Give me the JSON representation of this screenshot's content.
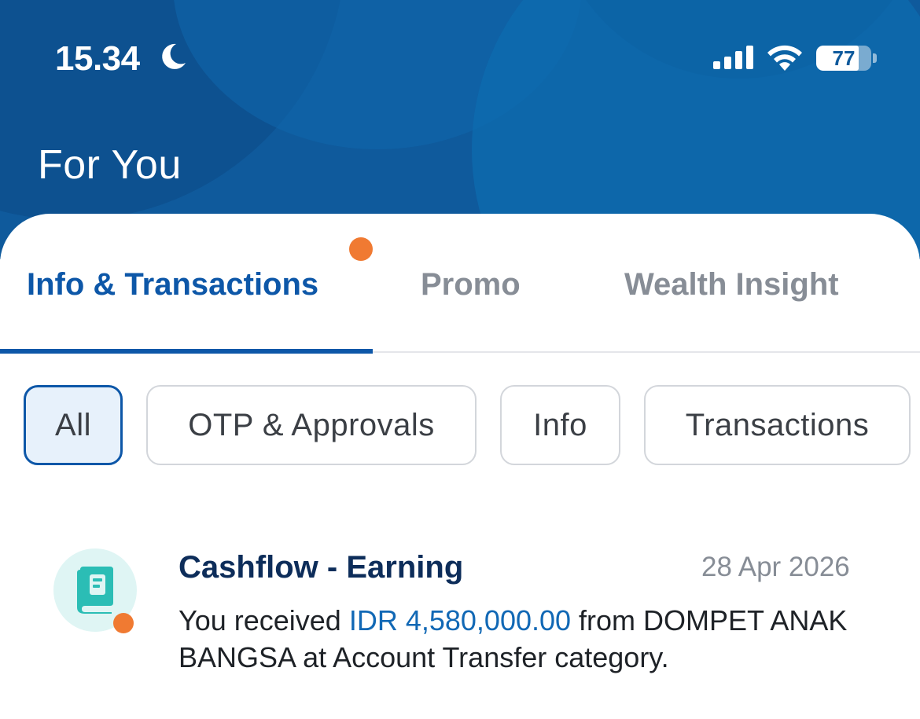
{
  "status_bar": {
    "time": "15.34",
    "battery_level": "77",
    "battery_fraction": 0.77,
    "icons": [
      "moon-icon",
      "signal-icon",
      "wifi-icon",
      "battery-icon"
    ]
  },
  "header": {
    "title": "For You"
  },
  "tabs": [
    {
      "label": "Info & Transactions",
      "active": true,
      "has_unread_dot": true
    },
    {
      "label": "Promo",
      "active": false
    },
    {
      "label": "Wealth Insight",
      "active": false
    }
  ],
  "filters": [
    {
      "label": "All",
      "selected": true
    },
    {
      "label": "OTP & Approvals",
      "selected": false
    },
    {
      "label": "Info",
      "selected": false
    },
    {
      "label": "Transactions",
      "selected": false
    }
  ],
  "notifications": [
    {
      "title": "Cashflow - Earning",
      "date": "28 Apr 2026",
      "body_prefix": "You received ",
      "amount": "IDR 4,580,000.00",
      "body_suffix": " from DOMPET ANAK BANGSA at Account Transfer category.",
      "icon": "book-icon",
      "unread": true
    }
  ],
  "colors": {
    "brand_blue": "#0d57a8",
    "header_blue": "#0f5a9c",
    "unread_orange": "#f07a32",
    "icon_teal": "#2bbdb5",
    "icon_bg": "#dff5f4"
  }
}
